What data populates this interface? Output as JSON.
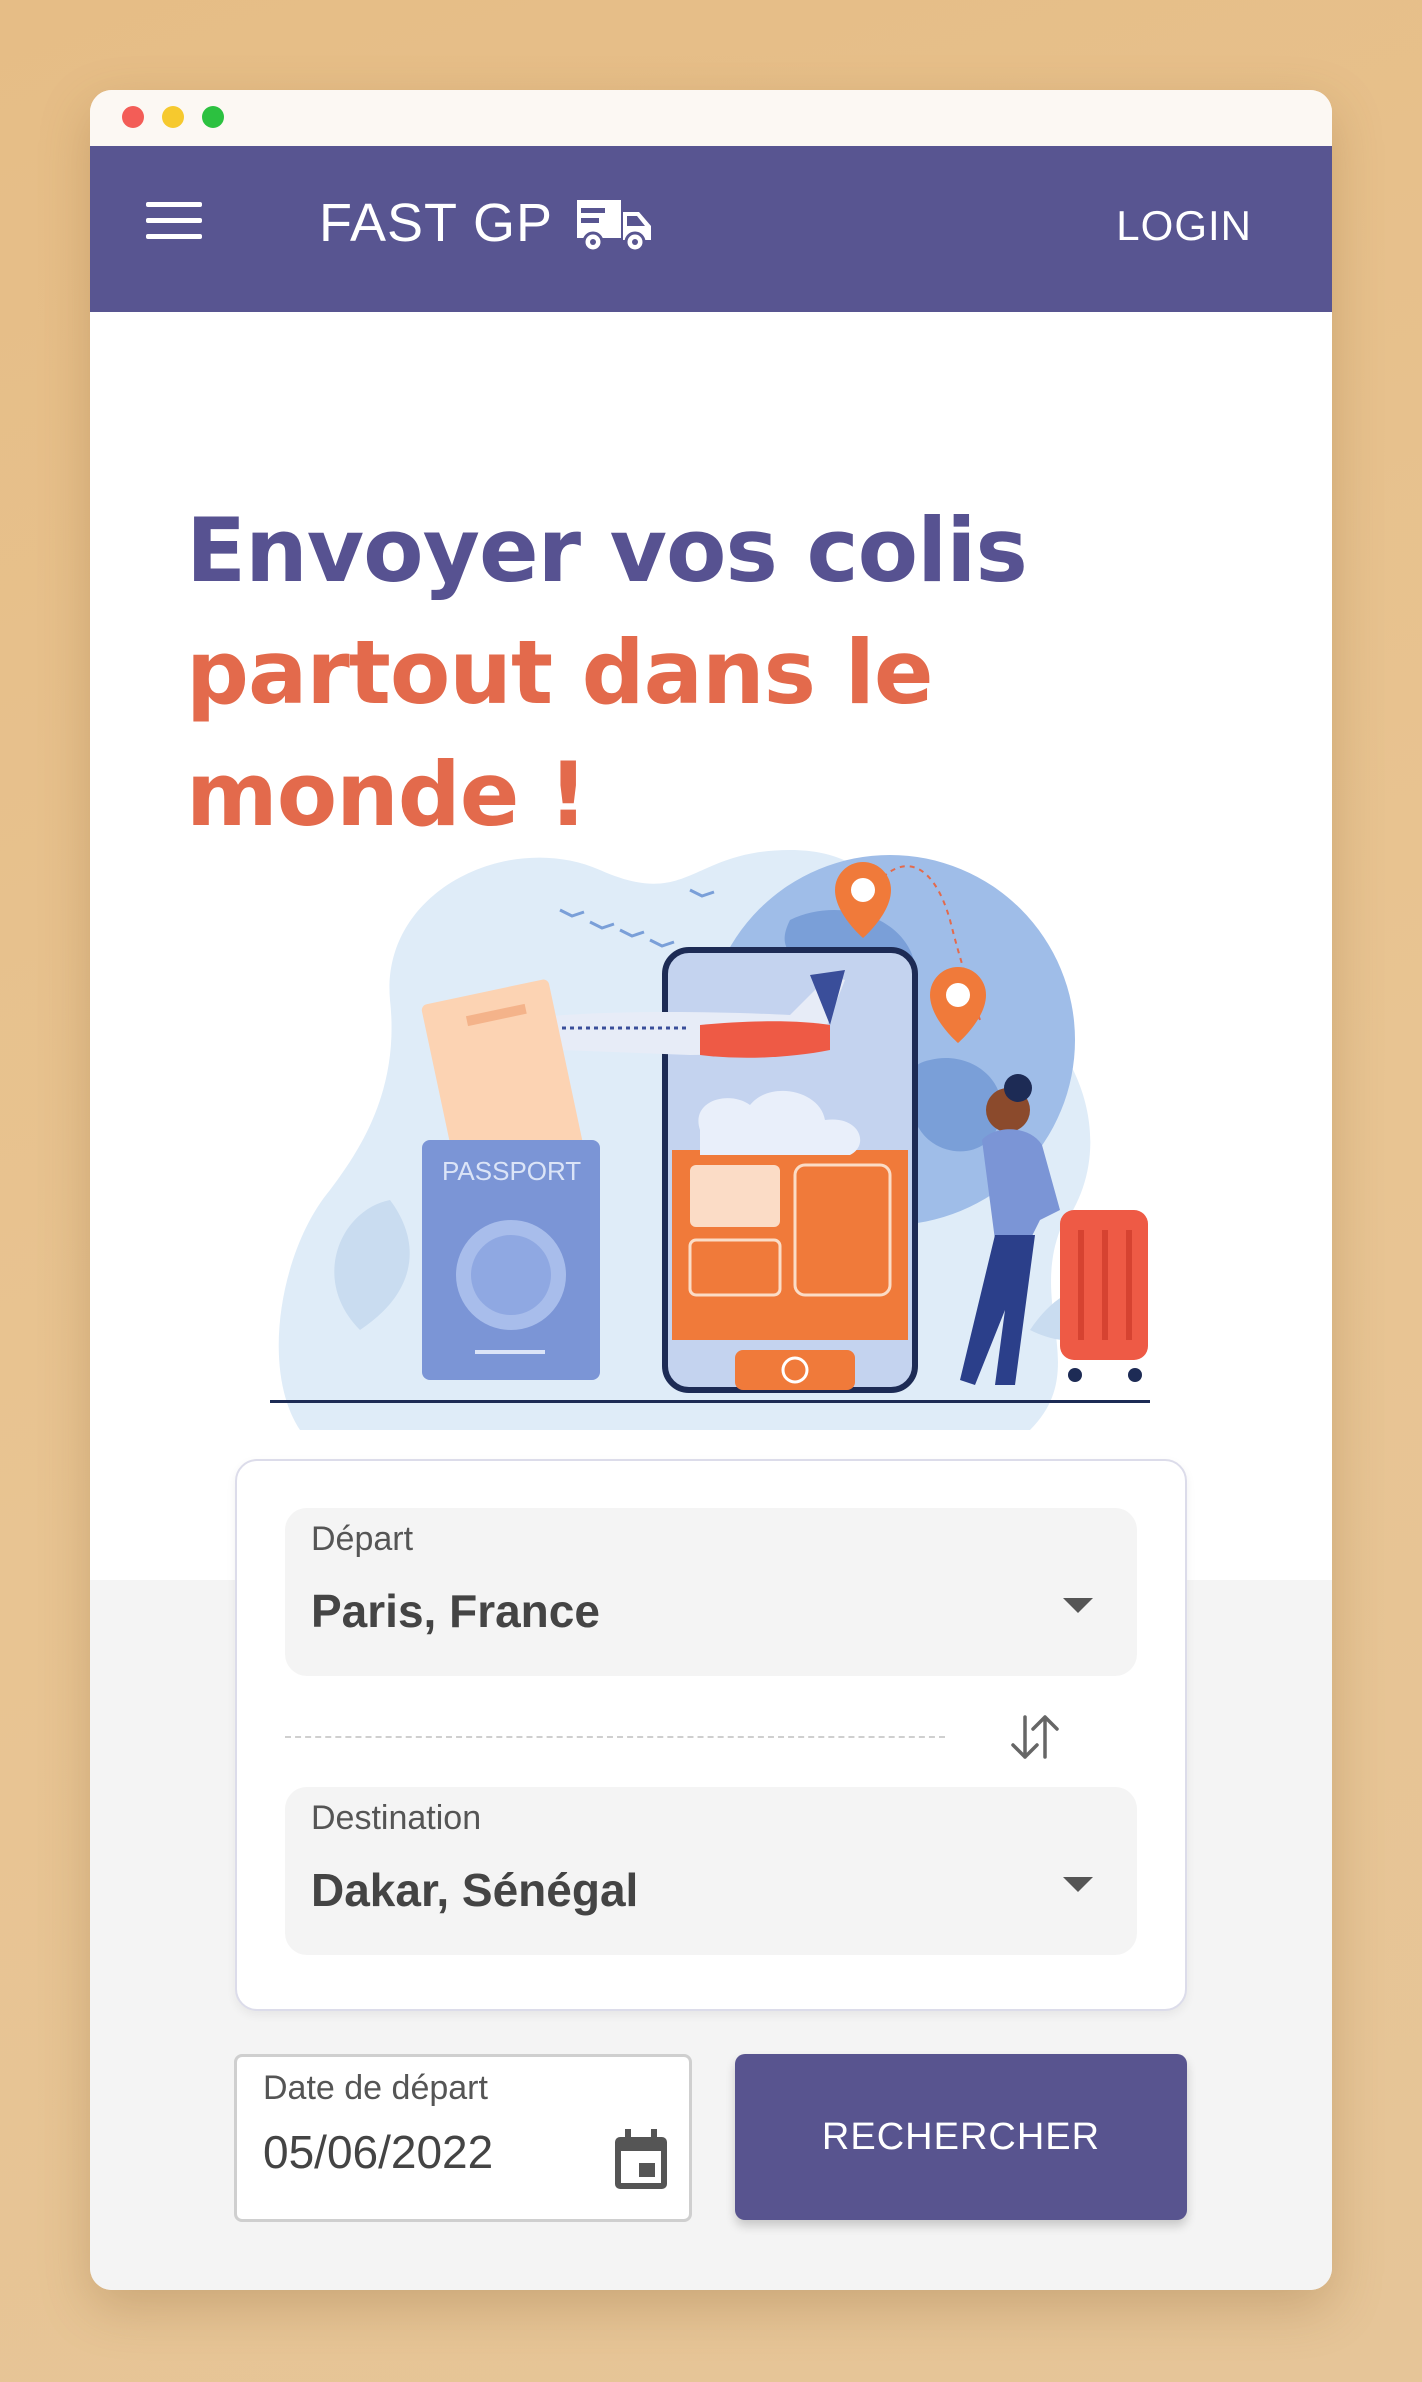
{
  "header": {
    "brand": "FAST GP",
    "login_label": "LOGIN",
    "icons": [
      "menu-icon",
      "truck-icon"
    ]
  },
  "hero": {
    "title_line1": "Envoyer vos colis",
    "title_line2": "partout dans le",
    "title_line3": "monde !"
  },
  "illustration": {
    "passport_label": "PASSPORT"
  },
  "form": {
    "departure": {
      "label": "Départ",
      "value": "Paris, France"
    },
    "destination": {
      "label": "Destination",
      "value": "Dakar, Sénégal"
    },
    "date": {
      "label": "Date de départ",
      "value": "05/06/2022"
    },
    "search_label": "RECHERCHER"
  },
  "colors": {
    "primary": "#585591",
    "accent": "#e36a4c",
    "page_bg": "#e6bd86"
  }
}
